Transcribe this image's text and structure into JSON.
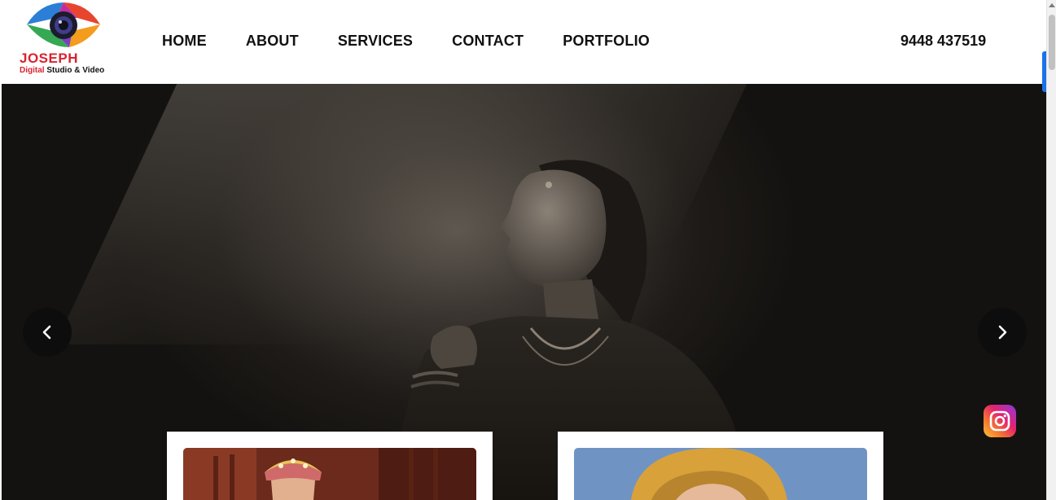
{
  "logo": {
    "name": "JOSEPH",
    "sub_highlight": "Digital",
    "sub_rest": " Studio & Video",
    "icon": "camera-lens-icon"
  },
  "nav": {
    "items": [
      {
        "label": "HOME"
      },
      {
        "label": "ABOUT"
      },
      {
        "label": "SERVICES"
      },
      {
        "label": "CONTACT"
      },
      {
        "label": "PORTFOLIO"
      }
    ]
  },
  "phone": "9448 437519",
  "hero": {
    "prev_icon": "chevron-left-icon",
    "next_icon": "chevron-right-icon",
    "image": "bride-in-light-beam-photo"
  },
  "social": {
    "instagram_icon": "instagram-icon"
  },
  "colors": {
    "brand_red": "#d9232e",
    "text": "#111111",
    "hero_dark": "#141210",
    "accent_blue": "#1a73e8"
  }
}
